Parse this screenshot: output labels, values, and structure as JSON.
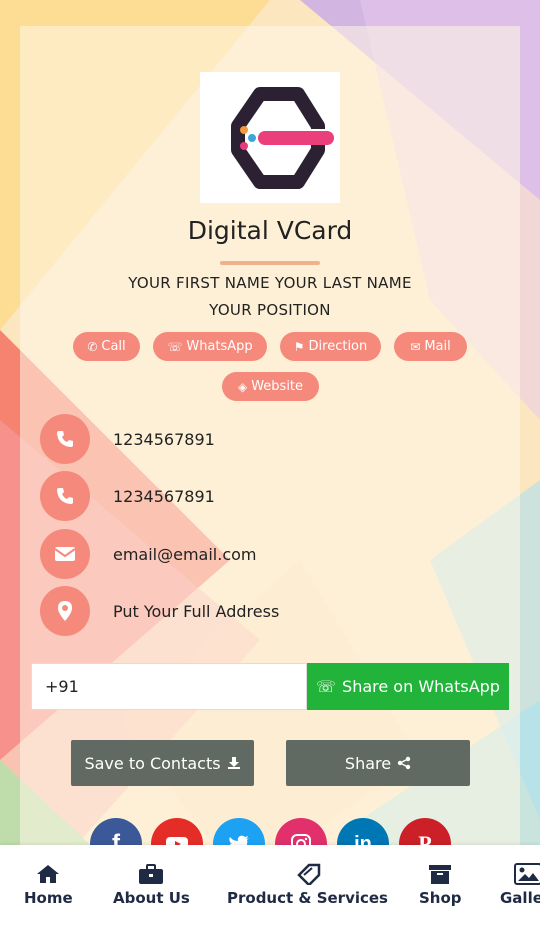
{
  "card": {
    "title": "Digital VCard",
    "full_name": "YOUR FIRST NAME YOUR LAST NAME",
    "position": "YOUR POSITION"
  },
  "actions": {
    "call": "Call",
    "whatsapp": "WhatsApp",
    "direction": "Direction",
    "mail": "Mail",
    "website": "Website"
  },
  "contacts": [
    {
      "icon": "phone-icon",
      "text": "1234567891"
    },
    {
      "icon": "phone-icon",
      "text": "1234567891"
    },
    {
      "icon": "envelope-icon",
      "text": "email@email.com"
    },
    {
      "icon": "map-marker-icon",
      "text": "Put Your Full Address"
    }
  ],
  "whatsapp_share": {
    "input_value": "+91",
    "button_label": "Share on WhatsApp"
  },
  "buttons": {
    "save_contacts": "Save to Contacts",
    "share": "Share"
  },
  "social": [
    "facebook-icon",
    "youtube-icon",
    "twitter-icon",
    "instagram-icon",
    "linkedin-icon",
    "pinterest-icon"
  ],
  "nav": {
    "home": "Home",
    "about": "About Us",
    "products": "Product & Services",
    "shop": "Shop",
    "gallery": "Gallery"
  },
  "colors": {
    "accent": "#f58a7c",
    "whatsapp_green": "#22b43a",
    "dark_button": "#606a62",
    "nav_text": "#1f2a44"
  }
}
